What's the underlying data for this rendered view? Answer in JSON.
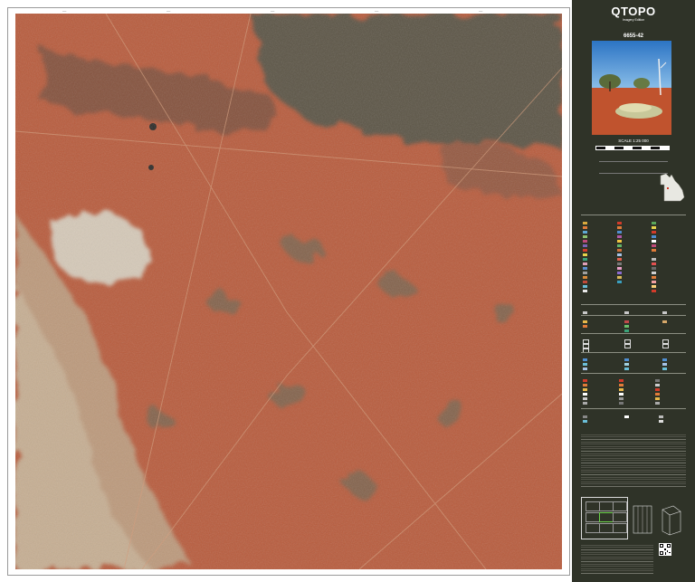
{
  "panel": {
    "title": "QTOPO",
    "subtitle": "Imagery Edition",
    "sheet_number": "6655-42",
    "scale": "SCALE 1:25 000"
  },
  "colors": {
    "panel_bg": "#2f3328",
    "imagery_base": "#b5533a",
    "vegetation_dark": "#4b5346",
    "clay_pan": "#d7cfbf"
  },
  "icons": [
    "landscape-photo",
    "queensland-locator-icon",
    "qr-code-icon"
  ]
}
